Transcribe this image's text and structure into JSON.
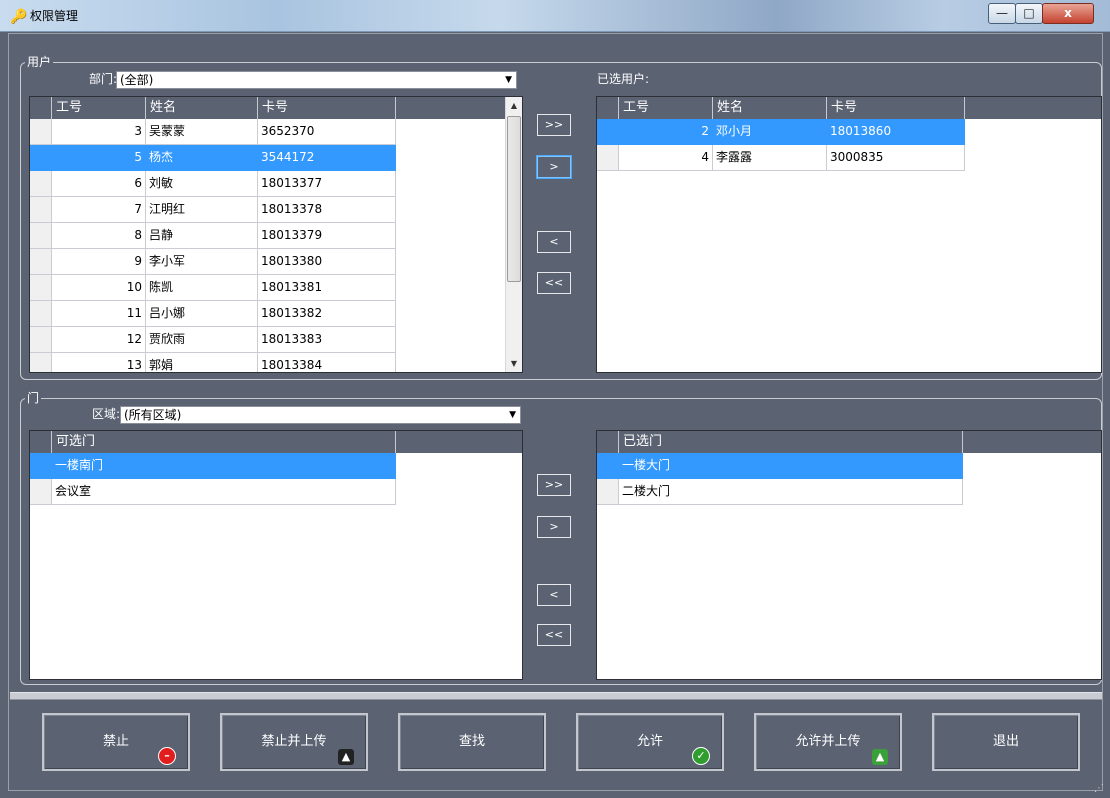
{
  "window": {
    "title": "权限管理",
    "icons": {
      "app": "key-icon",
      "minimize": "minimize-icon",
      "maximize": "maximize-icon",
      "close": "close-icon"
    },
    "caption": {
      "minimize": "—",
      "maximize": "□",
      "close": "x"
    }
  },
  "users_group": {
    "legend": "用户",
    "dept_label": "部门:",
    "dept_value": "(全部)",
    "selected_label": "已选用户:",
    "columns": [
      "工号",
      "姓名",
      "卡号"
    ],
    "available": [
      {
        "id": "3",
        "name": "吴蒙蒙",
        "card": "3652370"
      },
      {
        "id": "5",
        "name": "杨杰",
        "card": "3544172",
        "selected": true
      },
      {
        "id": "6",
        "name": "刘敏",
        "card": "18013377"
      },
      {
        "id": "7",
        "name": "江明红",
        "card": "18013378"
      },
      {
        "id": "8",
        "name": "吕静",
        "card": "18013379"
      },
      {
        "id": "9",
        "name": "李小军",
        "card": "18013380"
      },
      {
        "id": "10",
        "name": "陈凯",
        "card": "18013381"
      },
      {
        "id": "11",
        "name": "吕小娜",
        "card": "18013382"
      },
      {
        "id": "12",
        "name": "贾欣雨",
        "card": "18013383"
      },
      {
        "id": "13",
        "name": "郭娟",
        "card": "18013384"
      }
    ],
    "chosen": [
      {
        "id": "2",
        "name": "邓小月",
        "card": "18013860",
        "selected": true
      },
      {
        "id": "4",
        "name": "李露露",
        "card": "3000835"
      }
    ]
  },
  "doors_group": {
    "legend": "门",
    "area_label": "区域:",
    "area_value": "(所有区域)",
    "available_header": "可选门",
    "chosen_header": "已选门",
    "available": [
      {
        "name": "一楼南门",
        "selected": true
      },
      {
        "name": "会议室"
      }
    ],
    "chosen": [
      {
        "name": "一楼大门",
        "selected": true
      },
      {
        "name": "二楼大门"
      }
    ]
  },
  "transfer": {
    "add_all": ">>",
    "add": ">",
    "remove": "<",
    "remove_all": "<<"
  },
  "buttons": {
    "forbid": "禁止",
    "forbid_upload": "禁止并上传",
    "search": "查找",
    "allow": "允许",
    "allow_upload": "允许并上传",
    "exit": "退出"
  },
  "button_icons": {
    "forbid": "no-entry-icon",
    "forbid_upload": "upload-forbid-icon",
    "allow": "check-circle-icon",
    "allow_upload": "upload-allow-icon"
  },
  "colors": {
    "background": "#5b6272",
    "selection": "#3399ff"
  }
}
